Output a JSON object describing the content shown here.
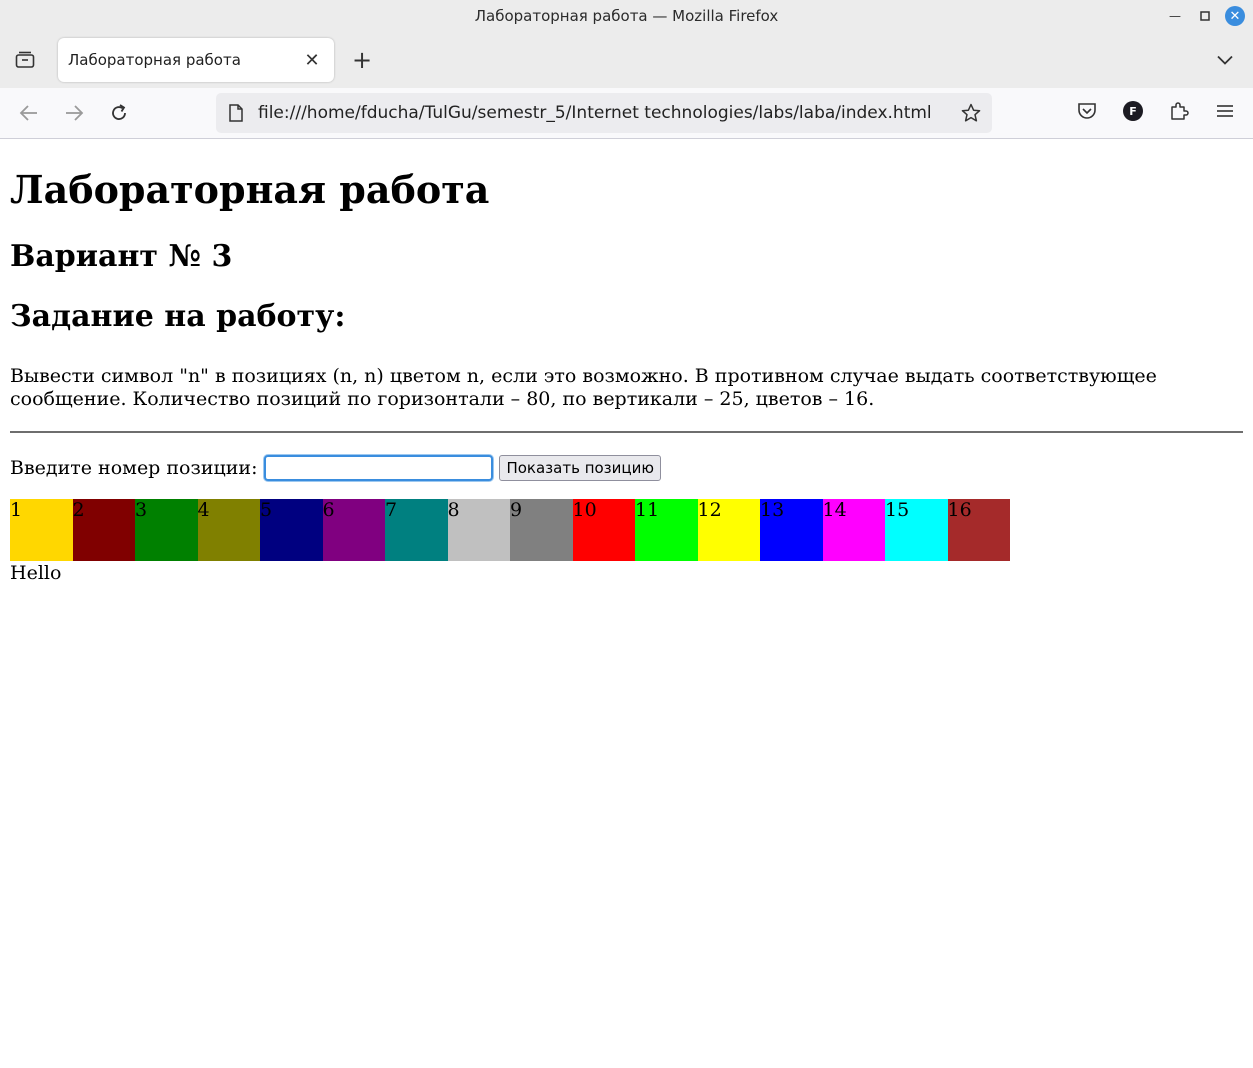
{
  "window": {
    "title": "Лабораторная работа — Mozilla Firefox"
  },
  "tabs": [
    {
      "title": "Лабораторная работа",
      "active": true
    }
  ],
  "navbar": {
    "url": "file:///home/fducha/TulGu/semestr_5/Internet technologies/labs/laba/index.html",
    "avatar_letter": "F"
  },
  "page": {
    "h1": "Лабораторная работа",
    "variant": "Вариант № 3",
    "task_heading": "Задание на работу:",
    "description": "Вывести символ \"n\" в позициях (n, n) цветом n, если это возможно. В противном случае выдать соответствующее сообщение. Количество позиций по горизонтали – 80, по вертикали – 25, цветов – 16.",
    "input_label": "Введите номер позиции:",
    "input_value": "",
    "button_label": "Показать позицию",
    "swatches": [
      {
        "label": "1",
        "color": "#FFD700"
      },
      {
        "label": "2",
        "color": "#800000"
      },
      {
        "label": "3",
        "color": "#008000"
      },
      {
        "label": "4",
        "color": "#808000"
      },
      {
        "label": "5",
        "color": "#000080"
      },
      {
        "label": "6",
        "color": "#800080"
      },
      {
        "label": "7",
        "color": "#008080"
      },
      {
        "label": "8",
        "color": "#C0C0C0"
      },
      {
        "label": "9",
        "color": "#808080"
      },
      {
        "label": "10",
        "color": "#FF0000"
      },
      {
        "label": "11",
        "color": "#00FF00"
      },
      {
        "label": "12",
        "color": "#FFFF00"
      },
      {
        "label": "13",
        "color": "#0000FF"
      },
      {
        "label": "14",
        "color": "#FF00FF"
      },
      {
        "label": "15",
        "color": "#00FFFF"
      },
      {
        "label": "16",
        "color": "#A52A2A"
      }
    ],
    "output_text": "Hello"
  }
}
